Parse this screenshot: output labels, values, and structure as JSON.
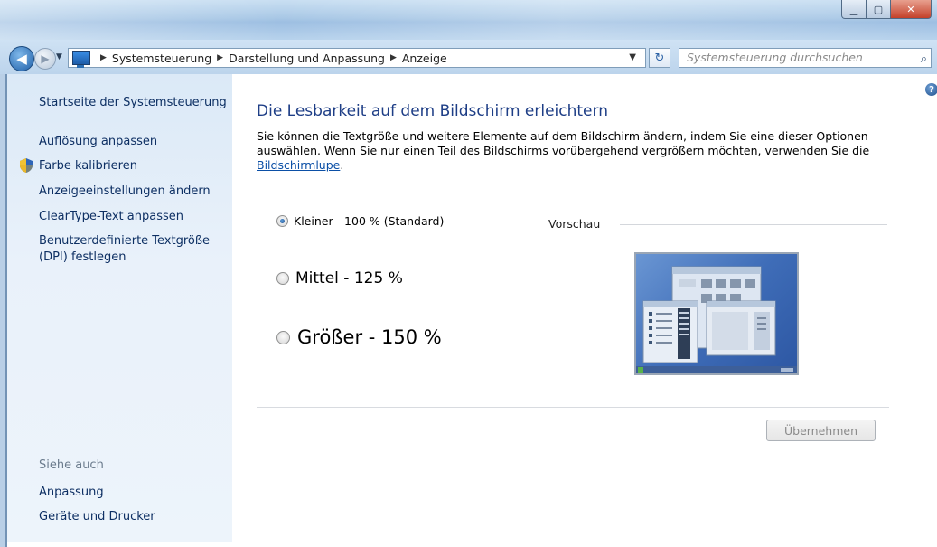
{
  "window": {
    "minimize_icon": "minimize-icon",
    "maximize_icon": "maximize-icon",
    "close_icon": "close-icon"
  },
  "nav": {
    "breadcrumbs": [
      "Systemsteuerung",
      "Darstellung und Anpassung",
      "Anzeige"
    ],
    "search_placeholder": "Systemsteuerung durchsuchen"
  },
  "sidebar": {
    "home": "Startseite der Systemsteuerung",
    "items": [
      "Auflösung anpassen",
      "Farbe kalibrieren",
      "Anzeigeeinstellungen ändern",
      "ClearType-Text anpassen",
      "Benutzerdefinierte Textgröße",
      "(DPI) festlegen"
    ],
    "see_also_title": "Siehe auch",
    "see_also": [
      "Anpassung",
      "Geräte und Drucker"
    ]
  },
  "main": {
    "title": "Die Lesbarkeit auf dem Bildschirm erleichtern",
    "description_line1": "Sie können die Textgröße und weitere Elemente auf dem Bildschirm ändern, indem Sie eine dieser Optionen",
    "description_line2": "auswählen. Wenn Sie nur einen Teil des Bildschirms vorübergehend vergrößern möchten, verwenden Sie die",
    "description_link": "Bildschirmlupe",
    "options": [
      {
        "label": "Kleiner - 100 % (Standard)",
        "selected": true
      },
      {
        "label": "Mittel - 125 %",
        "selected": false
      },
      {
        "label": "Größer - 150 %",
        "selected": false
      }
    ],
    "preview_label": "Vorschau",
    "apply_button": "Übernehmen"
  }
}
